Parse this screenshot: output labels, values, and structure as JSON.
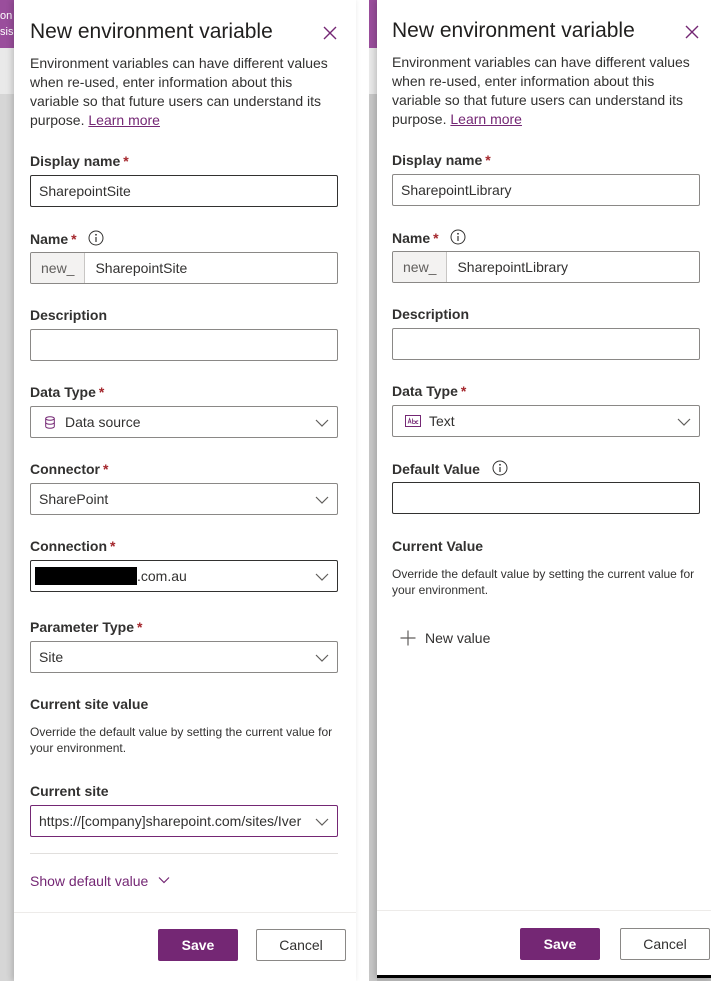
{
  "background": {
    "left_strip_text": "on\nsis",
    "right_strip_text": "",
    "accent": "#742774"
  },
  "left_panel": {
    "title": "New environment variable",
    "intro": "Environment variables can have different values when re-used, enter information about this variable so that future users can understand its purpose.",
    "learn_more": "Learn more",
    "display_name": {
      "label": "Display name",
      "value": "SharepointSite"
    },
    "name": {
      "label": "Name",
      "prefix": "new_",
      "value": "SharepointSite"
    },
    "description": {
      "label": "Description",
      "value": ""
    },
    "data_type": {
      "label": "Data Type",
      "value": "Data source",
      "icon": "database-icon"
    },
    "connector": {
      "label": "Connector",
      "value": "SharePoint"
    },
    "connection": {
      "label": "Connection",
      "value_suffix": ".com.au"
    },
    "parameter_type": {
      "label": "Parameter Type",
      "value": "Site"
    },
    "current_site_value": {
      "heading": "Current site value",
      "help": "Override the default value by setting the current value for your environment."
    },
    "current_site": {
      "label": "Current site",
      "value": "https://[company]sharepoint.com/sites/Iver"
    },
    "show_default": "Show default value",
    "save": "Save",
    "cancel": "Cancel"
  },
  "right_panel": {
    "title": "New environment variable",
    "intro": "Environment variables can have different values when re-used, enter information about this variable so that future users can understand its purpose.",
    "learn_more": "Learn more",
    "display_name": {
      "label": "Display name",
      "value": "SharepointLibrary"
    },
    "name": {
      "label": "Name",
      "prefix": "new_",
      "value": "SharepointLibrary"
    },
    "description": {
      "label": "Description",
      "value": ""
    },
    "data_type": {
      "label": "Data Type",
      "value": "Text",
      "icon": "text-abc-icon"
    },
    "default_value": {
      "label": "Default Value",
      "value": ""
    },
    "current_value": {
      "heading": "Current Value",
      "help": "Override the default value by setting the current value for your environment."
    },
    "new_value": "New value",
    "save": "Save",
    "cancel": "Cancel"
  }
}
